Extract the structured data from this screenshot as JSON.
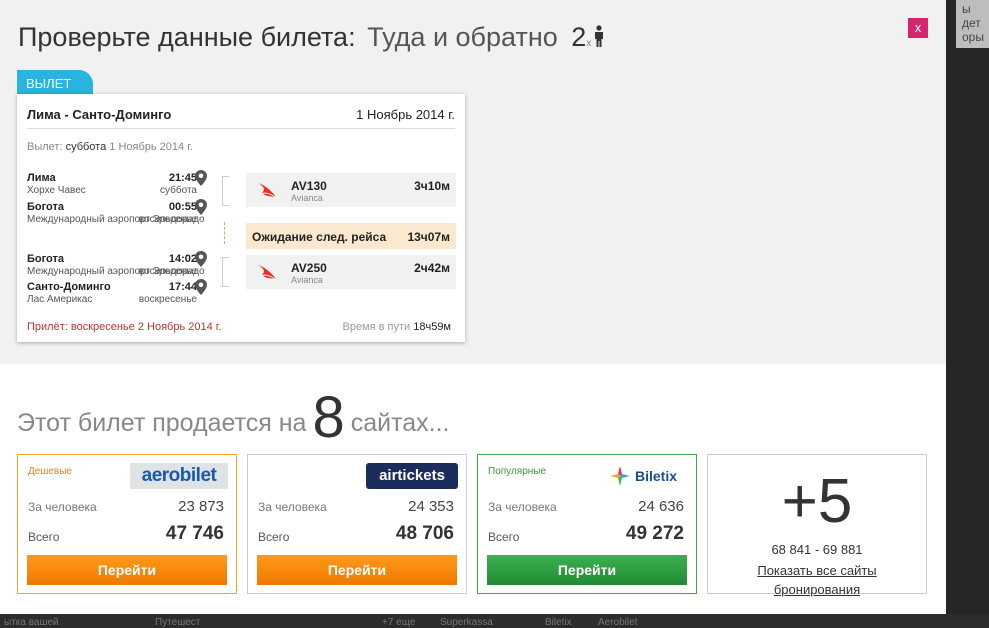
{
  "background": {
    "right_text": "ы\nдет\nоры в",
    "bottom_items": [
      "ытка вашей",
      "Путешест",
      "+7 еще",
      "Superkassa",
      "Biletix",
      "Aerobilet"
    ]
  },
  "modal": {
    "close_label": "x",
    "title": "Проверьте данные билета:",
    "trip_type": "Туда и обратно",
    "passengers": "2",
    "passengers_suffix": "x"
  },
  "outbound": {
    "tab_label": "ВЫЛЕТ",
    "route": "Лима - Санто-Доминго",
    "date": "1 Ноябрь 2014 г.",
    "departure_prefix": "Вылет:",
    "departure_day": "суббота",
    "departure_date": "1 Ноябрь 2014 г.",
    "segments": [
      {
        "from_city": "Лима",
        "from_time": "21:45",
        "from_port": "Хорхе Чавес",
        "from_day": "суббота",
        "to_city": "Богота",
        "to_time": "00:55",
        "to_port": "Международный аэропорт Эльдорадо",
        "to_day": "воскресенье",
        "flight": "AV130",
        "airline": "Avianca",
        "duration": "3ч10м"
      },
      {
        "from_city": "Богота",
        "from_time": "14:02",
        "from_port": "Международный аэропорт Эльдорадо",
        "from_day": "воскресенье",
        "to_city": "Санто-Доминго",
        "to_time": "17:44",
        "to_port": "Лас Америкас",
        "to_day": "воскресенье",
        "flight": "AV250",
        "airline": "Avianca",
        "duration": "2ч42м"
      }
    ],
    "layover_label": "Ожидание след. рейса",
    "layover_duration": "13ч07м",
    "arrival": "Прилёт: воскресенье 2 Ноябрь 2014 г.",
    "total_label": "Время в пути",
    "total_value": "18ч59м"
  },
  "sites": {
    "prefix": "Этот билет продается на",
    "count": "8",
    "suffix": "сайтах...",
    "offers": [
      {
        "badge": "Дешевые",
        "brand": "aerobilet",
        "per_person_label": "За человека",
        "per_person": "23 873",
        "total_label": "Всего",
        "total": "47 746",
        "button": "Перейти"
      },
      {
        "badge": "",
        "brand": "airtickets",
        "per_person_label": "За человека",
        "per_person": "24 353",
        "total_label": "Всего",
        "total": "48 706",
        "button": "Перейти"
      },
      {
        "badge": "Популярные",
        "brand": "Biletix",
        "per_person_label": "За человека",
        "per_person": "24 636",
        "total_label": "Всего",
        "total": "49 272",
        "button": "Перейти"
      }
    ],
    "more": {
      "count": "+5",
      "range": "68 841 - 69 881",
      "link": "Показать все сайты бронирования"
    }
  },
  "colors": {
    "accent_blue": "#29b3e0",
    "close_pink": "#d6246e",
    "orange_button": "#f07800",
    "green_button": "#228a34",
    "arrival_red": "#b33333",
    "layover_bg": "#fbe9cf"
  }
}
